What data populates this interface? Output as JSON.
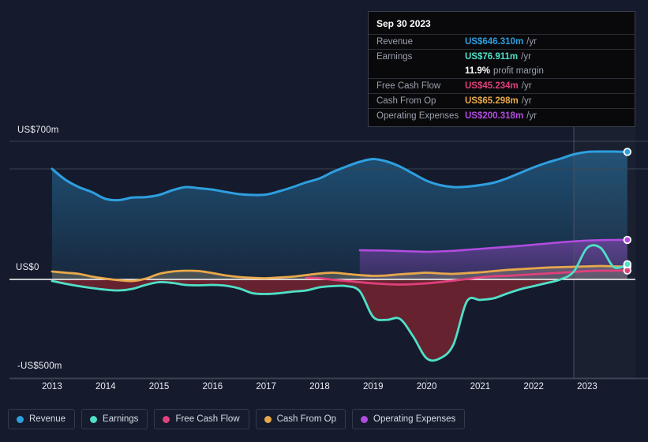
{
  "chart_data": {
    "type": "area",
    "title": "",
    "xlabel": "",
    "ylabel": "",
    "xlim": [
      2012.75,
      2023.9
    ],
    "ylim": [
      -560,
      760
    ],
    "grid": true,
    "zero_line": true,
    "currency": "US$",
    "unit": "m",
    "x_tick_labels": [
      "2013",
      "2014",
      "2015",
      "2016",
      "2017",
      "2018",
      "2019",
      "2020",
      "2021",
      "2022",
      "2023"
    ],
    "x_tick_values": [
      2013,
      2014,
      2015,
      2016,
      2017,
      2018,
      2019,
      2020,
      2021,
      2022,
      2023
    ],
    "y_tick_labels": [
      "US$700m",
      "US$0",
      "-US$500m"
    ],
    "y_tick_values": [
      700,
      0,
      -500
    ],
    "gridline_values": [
      700,
      560,
      -500
    ],
    "forecast_divider_x": 2022.75,
    "legend_position": "bottom-left",
    "colors": {
      "revenue": "#2e9fe0",
      "earnings": "#4fe0c8",
      "free_cash_flow": "#e0407c",
      "cash_from_op": "#e8a84a",
      "operating_expenses": "#b24ce0"
    },
    "series": [
      {
        "name": "Revenue",
        "color": "#2e9fe0",
        "x": [
          2013.0,
          2013.25,
          2013.5,
          2013.75,
          2014.0,
          2014.25,
          2014.5,
          2014.75,
          2015.0,
          2015.25,
          2015.5,
          2015.75,
          2016.0,
          2016.25,
          2016.5,
          2016.75,
          2017.0,
          2017.25,
          2017.5,
          2017.75,
          2018.0,
          2018.25,
          2018.5,
          2018.75,
          2019.0,
          2019.25,
          2019.5,
          2019.75,
          2020.0,
          2020.25,
          2020.5,
          2020.75,
          2021.0,
          2021.25,
          2021.5,
          2021.75,
          2022.0,
          2022.25,
          2022.5,
          2022.75,
          2023.0,
          2023.25,
          2023.5,
          2023.75
        ],
        "values": [
          560,
          505,
          468,
          442,
          408,
          402,
          415,
          417,
          428,
          452,
          468,
          462,
          455,
          443,
          432,
          428,
          430,
          447,
          468,
          492,
          512,
          545,
          572,
          596,
          610,
          598,
          572,
          536,
          500,
          478,
          468,
          470,
          478,
          490,
          512,
          540,
          568,
          592,
          612,
          634,
          646,
          648,
          648,
          646.31
        ]
      },
      {
        "name": "Earnings",
        "color": "#4fe0c8",
        "x": [
          2013.0,
          2013.25,
          2013.5,
          2013.75,
          2014.0,
          2014.25,
          2014.5,
          2014.75,
          2015.0,
          2015.25,
          2015.5,
          2015.75,
          2016.0,
          2016.25,
          2016.5,
          2016.75,
          2017.0,
          2017.25,
          2017.5,
          2017.75,
          2018.0,
          2018.25,
          2018.5,
          2018.75,
          2019.0,
          2019.25,
          2019.5,
          2019.75,
          2020.0,
          2020.25,
          2020.5,
          2020.75,
          2021.0,
          2021.25,
          2021.5,
          2021.75,
          2022.0,
          2022.25,
          2022.5,
          2022.75,
          2023.0,
          2023.25,
          2023.5,
          2023.75
        ],
        "values": [
          -8,
          -22,
          -34,
          -44,
          -52,
          -56,
          -48,
          -28,
          -14,
          -18,
          -28,
          -30,
          -28,
          -32,
          -46,
          -70,
          -74,
          -70,
          -62,
          -56,
          -40,
          -34,
          -34,
          -60,
          -190,
          -205,
          -200,
          -290,
          -400,
          -400,
          -330,
          -112,
          -104,
          -96,
          -72,
          -50,
          -34,
          -18,
          0,
          40,
          160,
          160,
          62,
          76.911
        ]
      },
      {
        "name": "Free Cash Flow",
        "color": "#e0407c",
        "x": [
          2017.75,
          2018.0,
          2018.25,
          2018.5,
          2018.75,
          2019.0,
          2019.25,
          2019.5,
          2019.75,
          2020.0,
          2020.25,
          2020.5,
          2020.75,
          2021.0,
          2021.25,
          2021.5,
          2021.75,
          2022.0,
          2022.25,
          2022.5,
          2022.75,
          2023.0,
          2023.25,
          2023.5,
          2023.75
        ],
        "values": [
          8,
          6,
          -2,
          -8,
          -14,
          -20,
          -24,
          -26,
          -24,
          -20,
          -14,
          -6,
          2,
          10,
          16,
          18,
          22,
          26,
          30,
          34,
          38,
          42,
          44,
          44,
          45.234
        ]
      },
      {
        "name": "Cash From Op",
        "color": "#e8a84a",
        "x": [
          2013.0,
          2013.25,
          2013.5,
          2013.75,
          2014.0,
          2014.25,
          2014.5,
          2014.75,
          2015.0,
          2015.25,
          2015.5,
          2015.75,
          2016.0,
          2016.25,
          2016.5,
          2016.75,
          2017.0,
          2017.25,
          2017.5,
          2017.75,
          2018.0,
          2018.25,
          2018.5,
          2018.75,
          2019.0,
          2019.25,
          2019.5,
          2019.75,
          2020.0,
          2020.25,
          2020.5,
          2020.75,
          2021.0,
          2021.25,
          2021.5,
          2021.75,
          2022.0,
          2022.25,
          2022.5,
          2022.75,
          2023.0,
          2023.25,
          2023.5,
          2023.75
        ],
        "values": [
          40,
          34,
          28,
          14,
          4,
          -4,
          -8,
          4,
          28,
          40,
          44,
          42,
          32,
          20,
          12,
          8,
          6,
          10,
          14,
          22,
          30,
          34,
          28,
          22,
          18,
          20,
          26,
          30,
          34,
          30,
          28,
          32,
          36,
          42,
          48,
          52,
          56,
          60,
          62,
          64,
          66,
          68,
          66,
          65.298
        ]
      },
      {
        "name": "Operating Expenses",
        "color": "#b24ce0",
        "x": [
          2018.75,
          2019.0,
          2019.25,
          2019.5,
          2019.75,
          2020.0,
          2020.25,
          2020.5,
          2020.75,
          2021.0,
          2021.25,
          2021.5,
          2021.75,
          2022.0,
          2022.25,
          2022.5,
          2022.75,
          2023.0,
          2023.25,
          2023.5,
          2023.75
        ],
        "values": [
          148,
          147,
          146,
          144,
          142,
          140,
          142,
          145,
          150,
          155,
          160,
          165,
          170,
          176,
          182,
          188,
          193,
          197,
          199,
          200,
          200.318
        ]
      }
    ]
  },
  "tooltip": {
    "title": "Sep 30 2023",
    "rows": [
      {
        "label": "Revenue",
        "value": "US$646.310m",
        "unit": "/yr",
        "color": "#2e9fe0"
      },
      {
        "label": "Earnings",
        "value": "US$76.911m",
        "unit": "/yr",
        "color": "#4fe0c8"
      },
      {
        "label": "Free Cash Flow",
        "value": "US$45.234m",
        "unit": "/yr",
        "color": "#e0407c"
      },
      {
        "label": "Cash From Op",
        "value": "US$65.298m",
        "unit": "/yr",
        "color": "#e8a84a"
      },
      {
        "label": "Operating Expenses",
        "value": "US$200.318m",
        "unit": "/yr",
        "color": "#b24ce0"
      }
    ],
    "margin_value": "11.9%",
    "margin_text": "profit margin"
  },
  "legend": {
    "items": [
      {
        "label": "Revenue",
        "color": "#2e9fe0"
      },
      {
        "label": "Earnings",
        "color": "#4fe0c8"
      },
      {
        "label": "Free Cash Flow",
        "color": "#e0407c"
      },
      {
        "label": "Cash From Op",
        "color": "#e8a84a"
      },
      {
        "label": "Operating Expenses",
        "color": "#b24ce0"
      }
    ]
  },
  "axis": {
    "y_top": "US$700m",
    "y_zero": "US$0",
    "y_bottom": "-US$500m"
  }
}
